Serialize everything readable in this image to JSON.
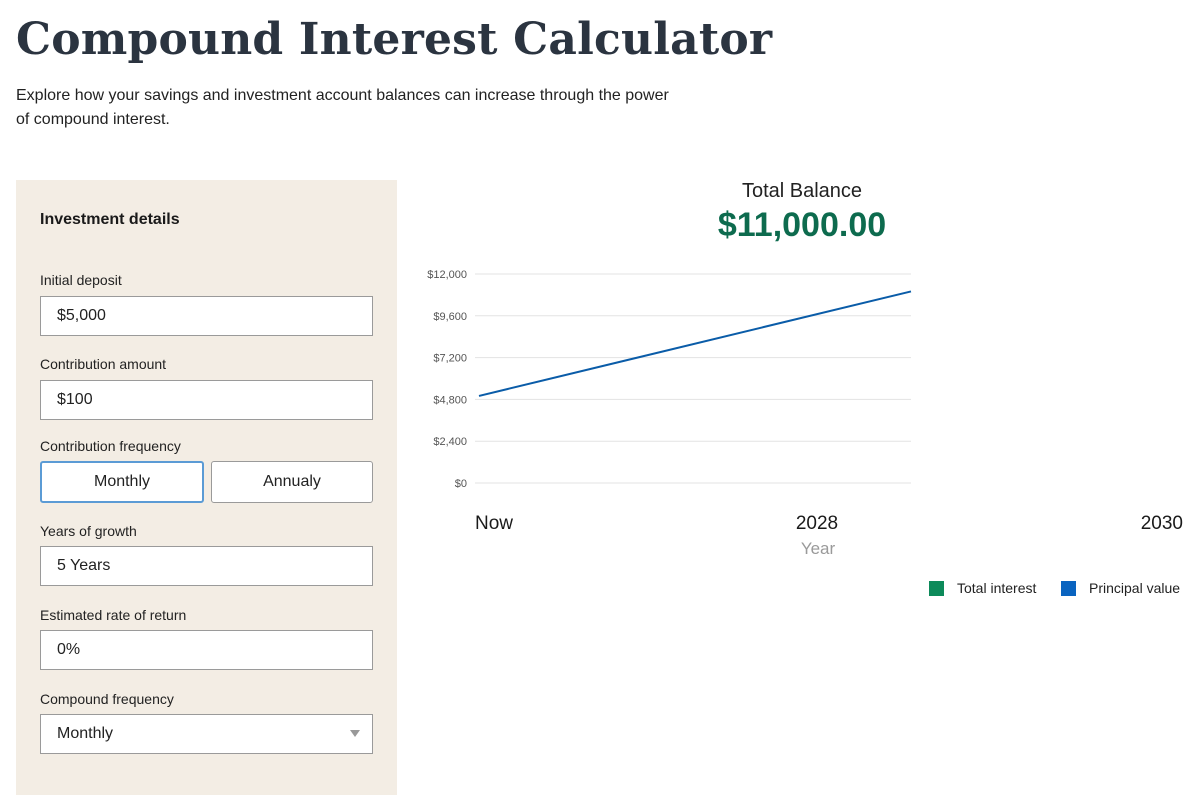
{
  "page": {
    "title": "Compound Interest Calculator",
    "intro": "Explore how your savings and investment account balances can increase through the power of compound interest."
  },
  "form": {
    "heading": "Investment details",
    "initial_deposit": {
      "label": "Initial deposit",
      "value": "$5,000"
    },
    "contribution_amount": {
      "label": "Contribution amount",
      "value": "$100"
    },
    "contribution_frequency": {
      "label": "Contribution frequency",
      "options": [
        "Monthly",
        "Annualy"
      ],
      "selected": "Monthly"
    },
    "years_of_growth": {
      "label": "Years of growth",
      "value": "5 Years"
    },
    "rate_of_return": {
      "label": "Estimated rate of return",
      "value": "0%"
    },
    "compound_frequency": {
      "label": "Compound frequency",
      "value": "Monthly"
    }
  },
  "summary": {
    "total_balance_label": "Total Balance",
    "total_balance_value": "$11,000.00",
    "balance_color": "#0d6b4e"
  },
  "legend": {
    "items": [
      {
        "label": "Total interest",
        "color": "#0d8a5a"
      },
      {
        "label": "Principal value",
        "color": "#0a64c0"
      }
    ]
  },
  "chart_data": {
    "type": "line",
    "x": [
      0,
      5
    ],
    "series": [
      {
        "values": [
          5000,
          11000
        ],
        "color": "#0a5ca8"
      }
    ],
    "ylim": [
      0,
      12000
    ],
    "yticks": [
      0,
      2400,
      4800,
      7200,
      9600,
      12000
    ],
    "ytick_labels": [
      "$0",
      "$2,400",
      "$4,800",
      "$7,200",
      "$9,600",
      "$12,000"
    ],
    "xtick_labels": [
      "Now",
      "2028",
      "2030"
    ],
    "xlabel": "Year",
    "grid": true
  }
}
